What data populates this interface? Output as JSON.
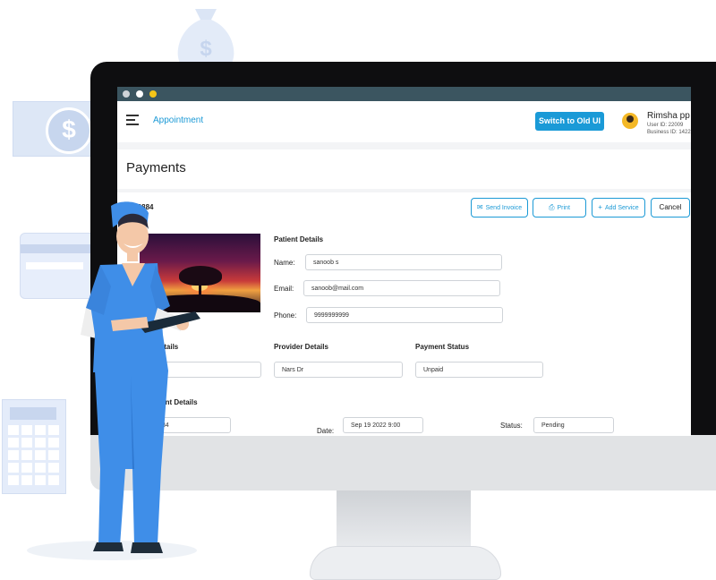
{
  "topbar": {
    "app_link": "Appointment",
    "switch_button": "Switch to Old UI",
    "user_name": "Rimsha pp",
    "user_id": "User ID: 22009",
    "business_id": "Business ID: 1422"
  },
  "page": {
    "title": "Payments"
  },
  "invoice": {
    "number_label": "ice #: 6884",
    "send_invoice": "Send Invoice",
    "print": "Print",
    "add_service": "Add Service",
    "cancel": "Cancel"
  },
  "patient": {
    "section_title": "Patient Details",
    "name_label": "Name:",
    "name_value": "sanoob s",
    "email_label": "Email:",
    "email_value": "sanoob@mail.com",
    "phone_label": "Phone:",
    "phone_value": "9999999999"
  },
  "details_row": {
    "service_title": "Details",
    "service_value": "esthetics",
    "provider_title": "Provider Details",
    "provider_value": "Nars Dr",
    "payment_status_title": "Payment Status",
    "payment_status_value": "Unpaid"
  },
  "payment": {
    "section_title": "ment Details",
    "amount_value": "384",
    "date_label": "Date:",
    "date_value": "Sep 19 2022 9:00",
    "status_label": "Status:",
    "status_value": "Pending"
  },
  "colors": {
    "accent": "#1c9ad6",
    "titlebar": "#3b5560",
    "scrub": "#3f8ee8"
  }
}
